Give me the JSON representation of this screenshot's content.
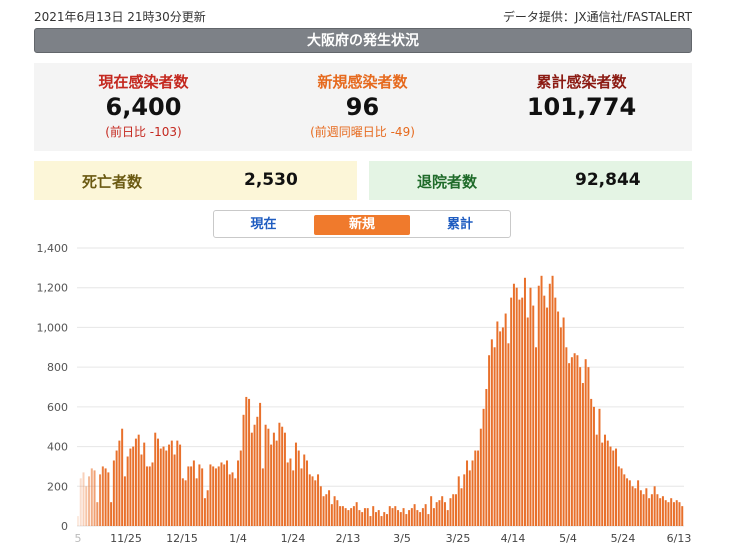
{
  "header": {
    "updated": "2021年6月13日 21時30分更新",
    "source": "データ提供：JX通信社/FASTALERT",
    "title": "大阪府の発生状況"
  },
  "stats": {
    "current": {
      "label": "現在感染者数",
      "value": "6,400",
      "sub": "(前日比 -103)"
    },
    "new": {
      "label": "新規感染者数",
      "value": "96",
      "sub": "(前週同曜日比 -49)"
    },
    "total": {
      "label": "累計感染者数",
      "value": "101,774"
    }
  },
  "deaths": {
    "label": "死亡者数",
    "value": "2,530"
  },
  "recovered": {
    "label": "退院者数",
    "value": "92,844"
  },
  "tabs": [
    "現在",
    "新規",
    "累計"
  ],
  "active_tab": "新規",
  "colors": {
    "bar": "#e8702b",
    "accent_red": "#c4281f",
    "accent_orange": "#e66a1e",
    "title_bg": "#7d8187"
  },
  "chart_data": {
    "type": "bar",
    "ylim": [
      0,
      1400
    ],
    "yticks": [
      0,
      200,
      400,
      600,
      800,
      1000,
      1200,
      1400
    ],
    "ytick_labels": [
      "0",
      "200",
      "400",
      "600",
      "800",
      "1,000",
      "1,200",
      "1,400"
    ],
    "xtick_labels": [
      "11/25",
      "12/15",
      "1/4",
      "1/24",
      "2/13",
      "3/5",
      "3/25",
      "4/14",
      "5/4",
      "5/24",
      "6/13"
    ],
    "first_tick_fragment": "5",
    "grid": true,
    "values": [
      50,
      240,
      270,
      200,
      250,
      290,
      280,
      120,
      260,
      300,
      290,
      270,
      120,
      330,
      380,
      430,
      490,
      250,
      350,
      390,
      400,
      440,
      460,
      360,
      420,
      300,
      300,
      320,
      470,
      440,
      390,
      400,
      380,
      410,
      430,
      360,
      430,
      410,
      240,
      230,
      300,
      300,
      330,
      240,
      310,
      290,
      140,
      180,
      310,
      300,
      290,
      300,
      320,
      310,
      330,
      260,
      270,
      240,
      330,
      380,
      560,
      650,
      640,
      470,
      510,
      550,
      620,
      290,
      510,
      490,
      410,
      470,
      430,
      520,
      500,
      470,
      320,
      340,
      280,
      420,
      380,
      290,
      360,
      330,
      260,
      250,
      230,
      260,
      200,
      150,
      160,
      180,
      110,
      150,
      130,
      100,
      100,
      90,
      80,
      90,
      100,
      120,
      80,
      70,
      90,
      90,
      50,
      100,
      70,
      80,
      50,
      70,
      60,
      100,
      90,
      100,
      80,
      70,
      90,
      60,
      80,
      90,
      110,
      80,
      70,
      90,
      110,
      60,
      150,
      90,
      120,
      130,
      150,
      120,
      80,
      140,
      160,
      160,
      250,
      190,
      260,
      330,
      280,
      330,
      380,
      380,
      490,
      590,
      690,
      860,
      940,
      900,
      1030,
      980,
      1000,
      1070,
      920,
      1150,
      1220,
      1200,
      1140,
      1150,
      1250,
      1050,
      1200,
      1110,
      900,
      1210,
      1260,
      1160,
      1100,
      1220,
      1260,
      1150,
      1080,
      1000,
      1050,
      900,
      820,
      850,
      870,
      860,
      800,
      720,
      840,
      800,
      640,
      600,
      460,
      590,
      420,
      460,
      430,
      400,
      380,
      390,
      300,
      290,
      260,
      240,
      230,
      200,
      190,
      230,
      180,
      160,
      190,
      140,
      160,
      200,
      160,
      140,
      150,
      130,
      120,
      140,
      120,
      130,
      120,
      100
    ]
  }
}
